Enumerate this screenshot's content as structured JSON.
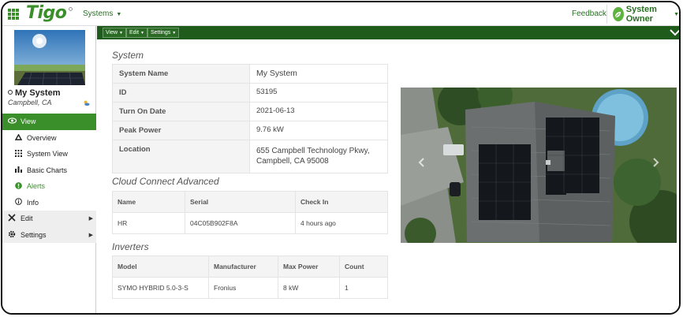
{
  "header": {
    "logo": "Tigo",
    "systems_menu": "Systems",
    "feedback": "Feedback",
    "owner": "System Owner"
  },
  "sidebar": {
    "system_name": "My System",
    "location": "Campbell, CA",
    "nav": [
      {
        "label": "View",
        "icon": "eye-icon"
      },
      {
        "label": "Overview",
        "icon": "triangle-icon"
      },
      {
        "label": "System View",
        "icon": "grid-icon"
      },
      {
        "label": "Basic Charts",
        "icon": "bar-chart-icon"
      },
      {
        "label": "Alerts",
        "icon": "alert-circle-icon"
      },
      {
        "label": "Info",
        "icon": "info-icon"
      },
      {
        "label": "Edit",
        "icon": "tools-icon"
      },
      {
        "label": "Settings",
        "icon": "gear-icon"
      }
    ]
  },
  "toolbar": {
    "view": "View",
    "edit": "Edit",
    "settings": "Settings"
  },
  "system": {
    "title": "System",
    "rows": [
      {
        "key": "System Name",
        "value": "My System"
      },
      {
        "key": "ID",
        "value": "53195"
      },
      {
        "key": "Turn On Date",
        "value": "2021-06-13"
      },
      {
        "key": "Peak Power",
        "value": "9.76 kW"
      },
      {
        "key": "Location",
        "value": "655 Campbell Technology Pkwy, Campbell, CA 95008"
      }
    ]
  },
  "cloud": {
    "title": "Cloud Connect Advanced",
    "headers": [
      "Name",
      "Serial",
      "Check In"
    ],
    "row": [
      "HR",
      "04C05B902F8A",
      "4 hours ago"
    ]
  },
  "inverters": {
    "title": "Inverters",
    "headers": [
      "Model",
      "Manufacturer",
      "Max Power",
      "Count"
    ],
    "row": [
      "SYMO HYBRID 5.0-3-S",
      "Fronius",
      "8 kW",
      "1"
    ]
  },
  "colors": {
    "brand_green": "#3a8f2a",
    "toolbar_green": "#1f5b1b"
  }
}
